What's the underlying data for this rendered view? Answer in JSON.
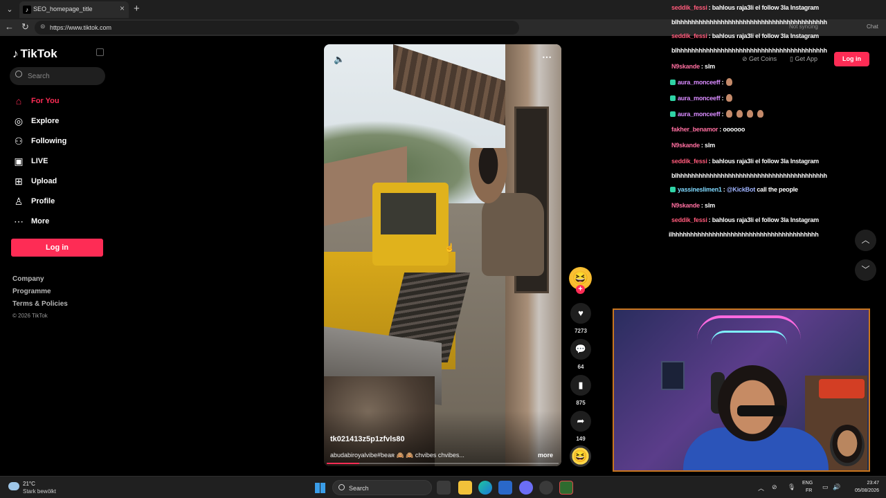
{
  "browser": {
    "tab_title": "SEO_homepage_title",
    "url": "https://www.tiktok.com",
    "sync_status": "Not syncing",
    "chat_label": "Chat"
  },
  "sidebar": {
    "logo": "TikTok",
    "search_placeholder": "Search",
    "nav": [
      {
        "label": "For You",
        "icon": "home-icon",
        "active": true
      },
      {
        "label": "Explore",
        "icon": "compass-icon"
      },
      {
        "label": "Following",
        "icon": "following-icon"
      },
      {
        "label": "LIVE",
        "icon": "live-icon"
      },
      {
        "label": "Upload",
        "icon": "upload-icon"
      },
      {
        "label": "Profile",
        "icon": "profile-icon"
      },
      {
        "label": "More",
        "icon": "more-icon"
      }
    ],
    "login_label": "Log in",
    "footer": [
      "Company",
      "Programme",
      "Terms & Policies"
    ],
    "copyright": "© 2026 TikTok"
  },
  "header": {
    "get_coins": "Get Coins",
    "get_app": "Get App",
    "login_label": "Log in"
  },
  "video": {
    "username": "tk021413z5p1zfvls80",
    "description": "abudabiroyalvibe#beaʀ 🙈 🙈 chvibes chvibes...",
    "more_label": "more",
    "progress": 0.14
  },
  "actions": {
    "likes": "7273",
    "comments": "64",
    "bookmarks": "875",
    "shares": "149"
  },
  "chat": [
    {
      "user": "seddik_fessi",
      "color": "#ff5a7a",
      "text": ": bahlous raja3li el follow 3la Instagram"
    },
    {
      "user": "",
      "color": "#ffffff",
      "text": "blhhhhhhhhhhhhhhhhhhhhhhhhhhhhhhhhhhhhhhhhh"
    },
    {
      "user": "seddik_fessi",
      "color": "#ff5a7a",
      "text": ": bahlous raja3li el follow 3la Instagram"
    },
    {
      "user": "",
      "color": "#ffffff",
      "text": "blhhhhhhhhhhhhhhhhhhhhhhhhhhhhhhhhhhhhhhhhh"
    },
    {
      "user": "N9skande",
      "color": "#ff6fa0",
      "text": ": slm"
    },
    {
      "user": "aura_monceeff",
      "color": "#d98bff",
      "text": ":",
      "badge": true,
      "emojis": 1
    },
    {
      "user": "aura_monceeff",
      "color": "#d98bff",
      "text": ":",
      "badge": true,
      "emojis": 1
    },
    {
      "user": "aura_monceeff",
      "color": "#d98bff",
      "text": ":",
      "badge": true,
      "emojis": 4
    },
    {
      "user": "fakher_benamor",
      "color": "#ff6fa0",
      "text": ": oooooo"
    },
    {
      "user": "N9skande",
      "color": "#ff6fa0",
      "text": ": slm"
    },
    {
      "user": "seddik_fessi",
      "color": "#ff5a7a",
      "text": ": bahlous raja3li el follow 3la Instagram"
    },
    {
      "user": "",
      "color": "#ffffff",
      "text": "blhhhhhhhhhhhhhhhhhhhhhhhhhhhhhhhhhhhhhhhhh"
    },
    {
      "user": "yassineslimen1",
      "color": "#7fd9ff",
      "text": ":",
      "badge": true,
      "mention": "@KickBot",
      "after": " call the people"
    },
    {
      "user": "N9skande",
      "color": "#ff6fa0",
      "text": ": slm"
    },
    {
      "user": "seddik_fessi",
      "color": "#ff5a7a",
      "text": ": bahlous raja3li el follow 3la Instagram"
    },
    {
      "user": "",
      "color": "#ffffff",
      "text": "ilhhhhhhhhhhhhhhhhhhhhhhhhhhhhhhhhhhhhhhhh"
    }
  ],
  "taskbar": {
    "temperature": "21°C",
    "weather": "Stark bewölkt",
    "search_label": "Search",
    "lang1": "ENG",
    "lang2": "FR",
    "time": "23:47",
    "date": "05/08/2026"
  },
  "colors": {
    "accent": "#fe2c55",
    "background": "#000000"
  }
}
